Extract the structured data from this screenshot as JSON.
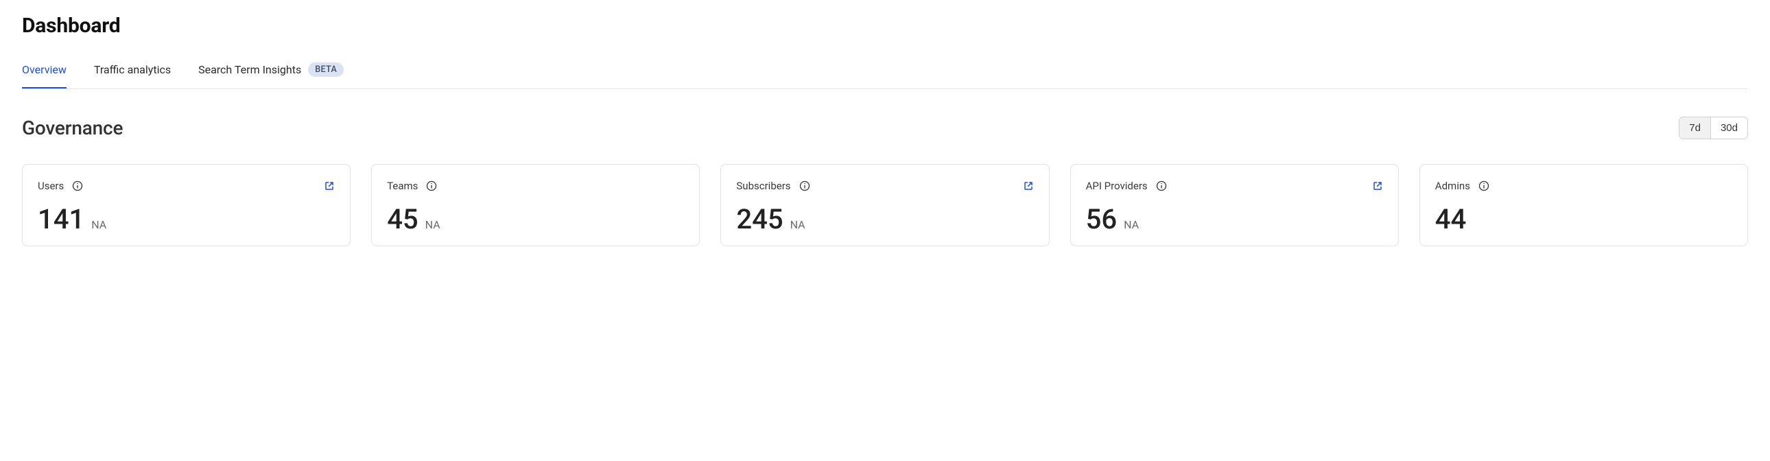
{
  "pageTitle": "Dashboard",
  "tabs": {
    "overview": "Overview",
    "traffic": "Traffic analytics",
    "search": "Search Term Insights",
    "searchBadge": "BETA"
  },
  "section": {
    "title": "Governance",
    "range": {
      "opt1": "7d",
      "opt2": "30d"
    }
  },
  "cards": {
    "users": {
      "label": "Users",
      "value": "141",
      "sub": "NA",
      "hasLink": true
    },
    "teams": {
      "label": "Teams",
      "value": "45",
      "sub": "NA",
      "hasLink": false
    },
    "subscribers": {
      "label": "Subscribers",
      "value": "245",
      "sub": "NA",
      "hasLink": true
    },
    "providers": {
      "label": "API Providers",
      "value": "56",
      "sub": "NA",
      "hasLink": true
    },
    "admins": {
      "label": "Admins",
      "value": "44",
      "sub": "",
      "hasLink": false
    }
  }
}
